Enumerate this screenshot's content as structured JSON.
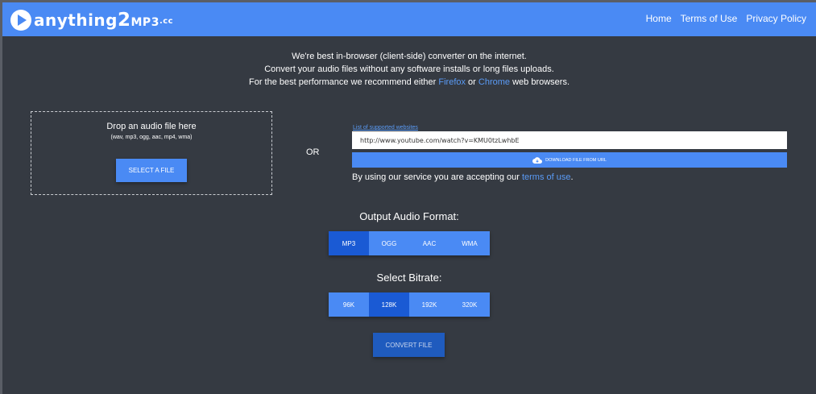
{
  "logo": {
    "part1": "anything",
    "part2": "2",
    "part3": "MP3",
    "part4": ".cc"
  },
  "nav": {
    "home": "Home",
    "terms": "Terms of Use",
    "privacy": "Privacy Policy"
  },
  "intro": {
    "line1": "We're best in-browser (client-side) converter on the internet.",
    "line2": "Convert your audio files without any software installs or long files uploads.",
    "line3_prefix": "For the best performance we recommend either ",
    "firefox": "Firefox",
    "line3_or": " or ",
    "chrome": "Chrome",
    "line3_suffix": " web browsers."
  },
  "dropzone": {
    "title": "Drop an audio file here",
    "formats": "(wav, mp3, ogg, aac, mp4, wma)",
    "select_label": "SELECT A FILE"
  },
  "or_label": "OR",
  "url": {
    "supported_link": "List of supported websites",
    "value": "http://www.youtube.com/watch?v=KMU0tzLwhbE",
    "download_label": "DOWNLOAD FILE FROM URL",
    "terms_prefix": "By using our service you are accepting our ",
    "terms_link": "terms of use",
    "terms_suffix": "."
  },
  "format": {
    "label": "Output Audio Format:",
    "options": [
      "MP3",
      "OGG",
      "AAC",
      "WMA"
    ],
    "selected": "MP3"
  },
  "bitrate": {
    "label": "Select Bitrate:",
    "options": [
      "96K",
      "128K",
      "192K",
      "320K"
    ],
    "selected": "128K"
  },
  "convert_label": "CONVERT FILE",
  "colors": {
    "accent": "#4a8af4",
    "active": "#1a5ad4",
    "background": "#353a42",
    "link": "#5a9bf6"
  },
  "icons": {
    "logo": "play-circle-icon",
    "download": "cloud-download-icon"
  }
}
